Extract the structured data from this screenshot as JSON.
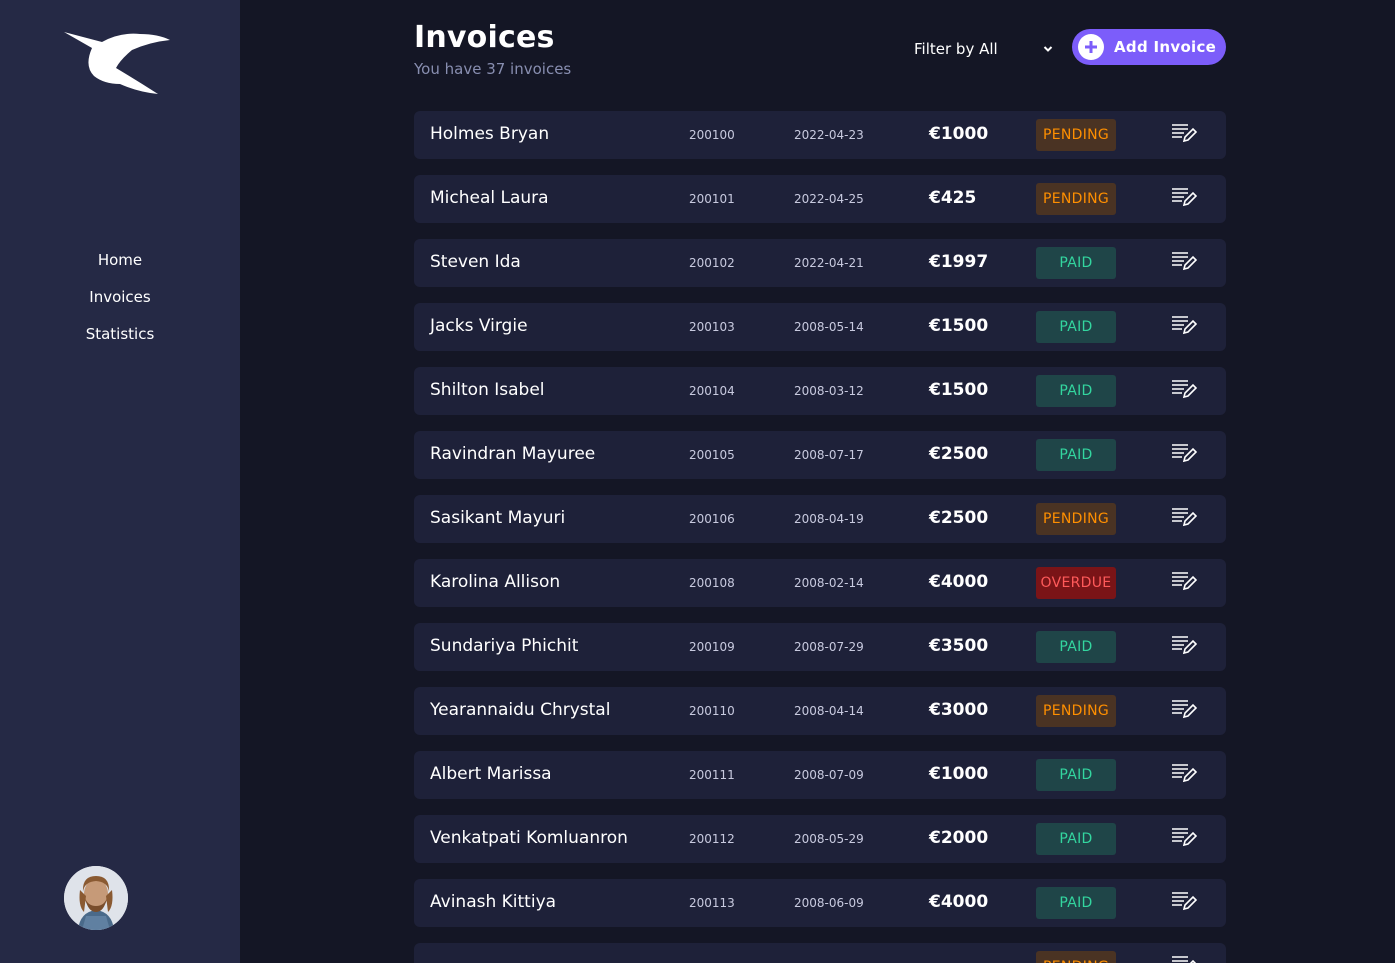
{
  "sidebar": {
    "logo": "hummingbird-logo",
    "nav": [
      {
        "label": "Home"
      },
      {
        "label": "Invoices"
      },
      {
        "label": "Statistics"
      }
    ],
    "avatar": "user-avatar"
  },
  "header": {
    "title": "Invoices",
    "subtitle": "You have 37 invoices",
    "filter_label": "Filter by All",
    "add_button_label": "Add Invoice"
  },
  "colors": {
    "background": "#141625",
    "sidebar": "#252945",
    "row": "#1e2139",
    "accent": "#7c5dfa",
    "pending_bg": "#4a3323",
    "pending_fg": "#ff8f00",
    "paid_bg": "#1f4548",
    "paid_fg": "#33d69f",
    "overdue_bg": "#7a1417",
    "overdue_fg": "#ff5a5a"
  },
  "invoices": [
    {
      "name": "Holmes Bryan",
      "id": "200100",
      "date": "2022-04-23",
      "amount": "€1000",
      "status": "PENDING"
    },
    {
      "name": "Micheal Laura",
      "id": "200101",
      "date": "2022-04-25",
      "amount": "€425",
      "status": "PENDING"
    },
    {
      "name": "Steven Ida",
      "id": "200102",
      "date": "2022-04-21",
      "amount": "€1997",
      "status": "PAID"
    },
    {
      "name": "Jacks Virgie",
      "id": "200103",
      "date": "2008-05-14",
      "amount": "€1500",
      "status": "PAID"
    },
    {
      "name": "Shilton Isabel",
      "id": "200104",
      "date": "2008-03-12",
      "amount": "€1500",
      "status": "PAID"
    },
    {
      "name": "Ravindran Mayuree",
      "id": "200105",
      "date": "2008-07-17",
      "amount": "€2500",
      "status": "PAID"
    },
    {
      "name": "Sasikant Mayuri",
      "id": "200106",
      "date": "2008-04-19",
      "amount": "€2500",
      "status": "PENDING"
    },
    {
      "name": "Karolina Allison",
      "id": "200108",
      "date": "2008-02-14",
      "amount": "€4000",
      "status": "OVERDUE"
    },
    {
      "name": "Sundariya Phichit",
      "id": "200109",
      "date": "2008-07-29",
      "amount": "€3500",
      "status": "PAID"
    },
    {
      "name": "Yearannaidu Chrystal",
      "id": "200110",
      "date": "2008-04-14",
      "amount": "€3000",
      "status": "PENDING"
    },
    {
      "name": "Albert Marissa",
      "id": "200111",
      "date": "2008-07-09",
      "amount": "€1000",
      "status": "PAID"
    },
    {
      "name": "Venkatpati Komluanron",
      "id": "200112",
      "date": "2008-05-29",
      "amount": "€2000",
      "status": "PAID"
    },
    {
      "name": "Avinash Kittiya",
      "id": "200113",
      "date": "2008-06-09",
      "amount": "€4000",
      "status": "PAID"
    },
    {
      "name": "",
      "id": "",
      "date": "",
      "amount": "",
      "status": "PENDING"
    }
  ]
}
